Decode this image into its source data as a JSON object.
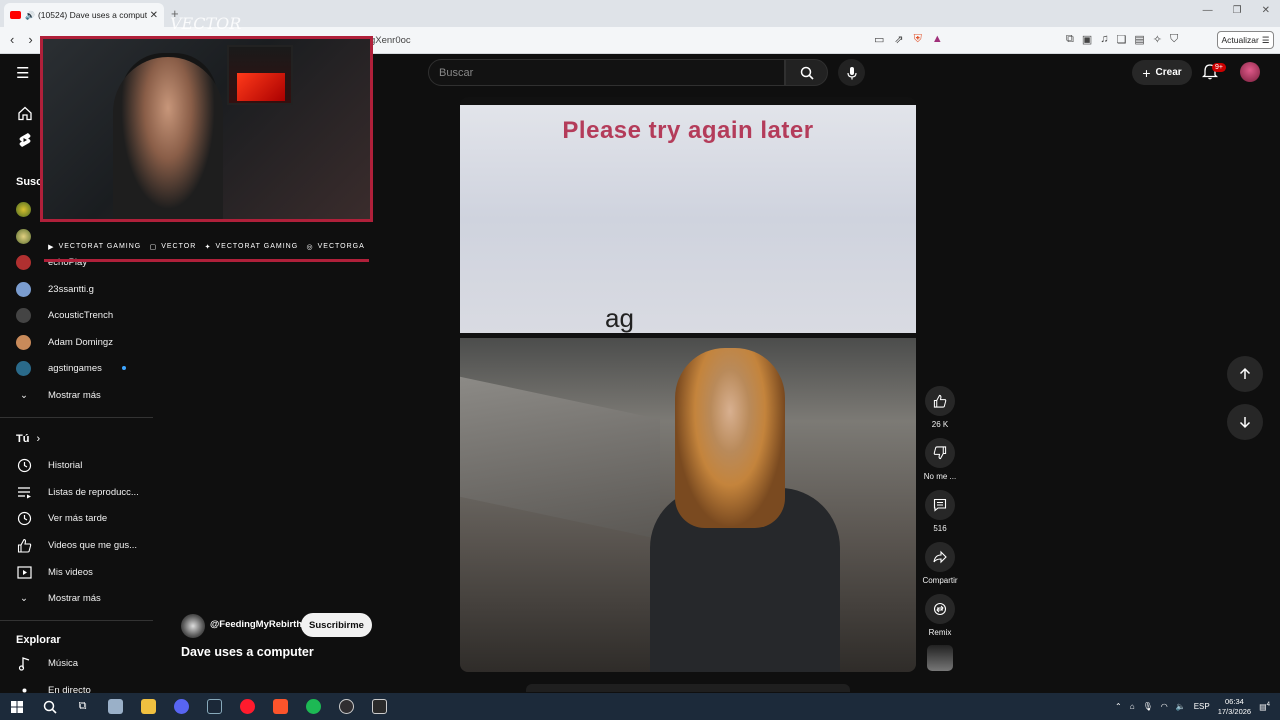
{
  "browser": {
    "tab_title": "(10524) Dave uses a compute",
    "url_fragment": "gXenr0oc",
    "update_label": "Actualizar"
  },
  "header": {
    "search_placeholder": "Buscar",
    "create_label": "Crear",
    "notifications_badge": "9+"
  },
  "sidebar": {
    "subscriptions_heading": "Susc",
    "subscriptions": [
      {
        "label": "echoPlay",
        "color": "#b03030"
      },
      {
        "label": "23ssantti.g",
        "color": "#7a9ccf"
      },
      {
        "label": "AcousticTrench",
        "color": "#444444"
      },
      {
        "label": "Adam Domingz",
        "color": "#c88a5a"
      },
      {
        "label": "agstingames",
        "color": "#2a6a8a",
        "new": true
      }
    ],
    "show_more_1": "Mostrar más",
    "you_heading": "Tú",
    "you_items": [
      {
        "label": "Historial",
        "icon": "history-icon"
      },
      {
        "label": "Listas de reproducc...",
        "icon": "playlists-icon"
      },
      {
        "label": "Ver más tarde",
        "icon": "watch-later-icon"
      },
      {
        "label": "Videos que me gus...",
        "icon": "liked-icon"
      },
      {
        "label": "Mis videos",
        "icon": "my-videos-icon"
      }
    ],
    "show_more_2": "Mostrar más",
    "explore_heading": "Explorar",
    "explore_items": [
      {
        "label": "Música",
        "icon": "music-icon"
      },
      {
        "label": "En directo",
        "icon": "live-icon"
      }
    ]
  },
  "overlay": {
    "logo": "VECTOR",
    "socials": [
      "VECTORAT GAMING",
      "VECTOR",
      "VECTORAT GAMING",
      "VECTORGA"
    ]
  },
  "video": {
    "top_text": "Please try again later",
    "subtitle_text": "ag",
    "channel": "@FeedingMyRebirth",
    "subscribe_label": "Suscribirme",
    "title": "Dave uses a computer"
  },
  "actions": {
    "likes": "26 K",
    "dislike": "No me ...",
    "comments": "516",
    "share": "Compartir",
    "remix": "Remix"
  },
  "taskbar": {
    "language": "ESP",
    "time": "06:34",
    "date": "17/3/2026",
    "notifications": "4"
  }
}
